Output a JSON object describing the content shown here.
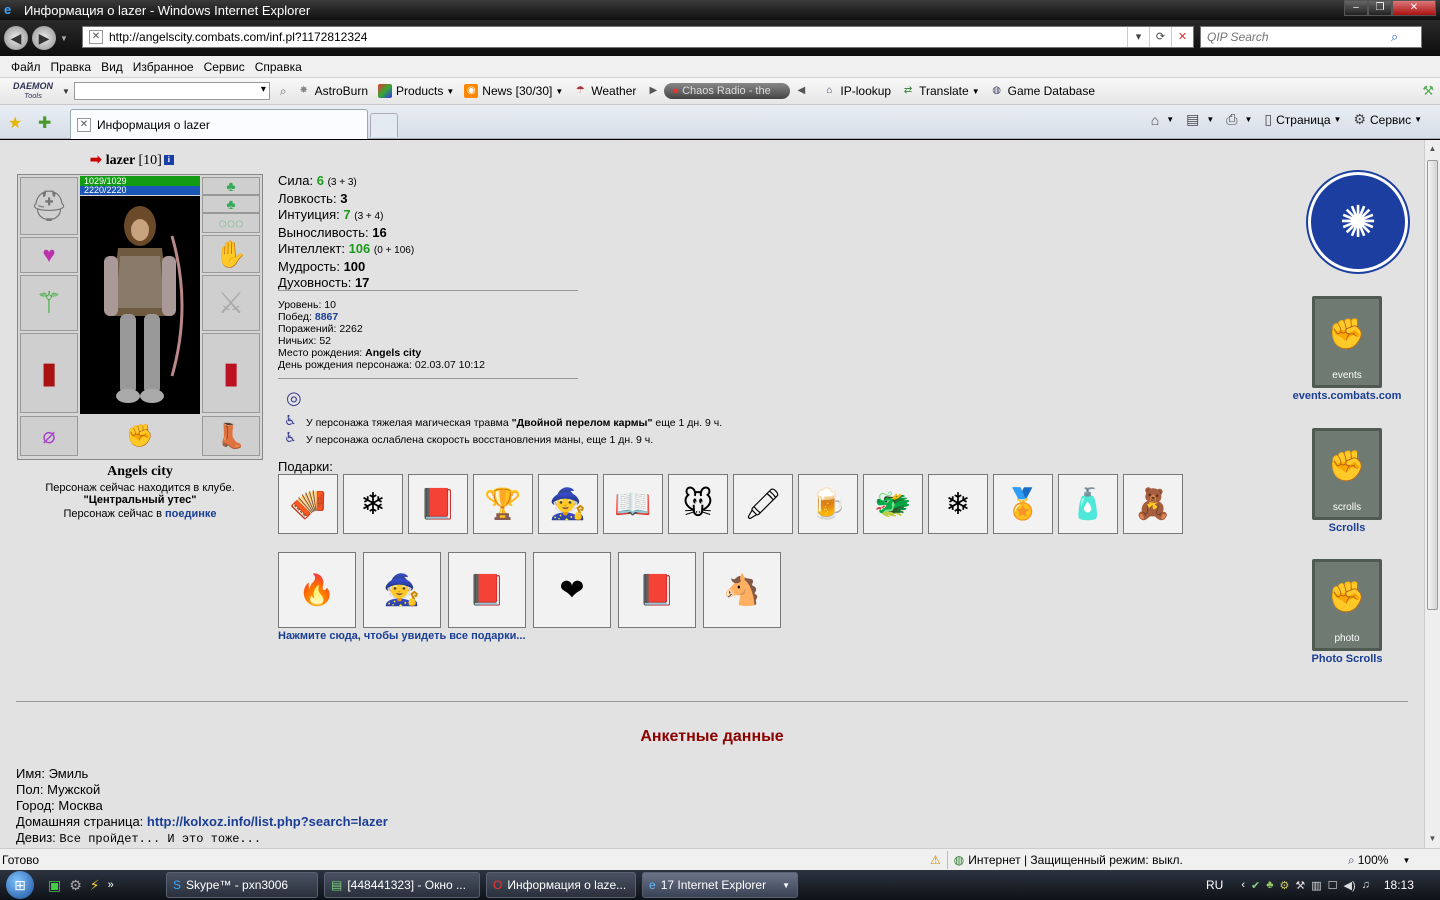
{
  "window": {
    "title": "Информация о lazer - Windows Internet Explorer",
    "buttons": [
      "–",
      "❐",
      "✕"
    ]
  },
  "address": {
    "url": "http://angelscity.combats.com/inf.pl?1172812324",
    "search_placeholder": "QIP Search"
  },
  "menu": [
    "Файл",
    "Правка",
    "Вид",
    "Избранное",
    "Сервис",
    "Справка"
  ],
  "links_toolbar": {
    "daemon_top": "DAEMON",
    "daemon_bottom": "Tools",
    "items": [
      {
        "label": "AstroBurn",
        "icon": "astroburn-icon"
      },
      {
        "label": "Products",
        "icon": "products-icon"
      },
      {
        "label": "News [30/30]",
        "icon": "rss-icon"
      },
      {
        "label": "Weather",
        "icon": "weather-icon"
      }
    ],
    "radio": "Chaos Radio - the",
    "items2": [
      {
        "label": "IP-lookup",
        "icon": "iplookup-icon"
      },
      {
        "label": "Translate",
        "icon": "translate-icon"
      },
      {
        "label": "Game Database",
        "icon": "database-icon"
      }
    ]
  },
  "tab": {
    "title": "Информация о lazer"
  },
  "commands": {
    "page": "Страница",
    "tools": "Сервис"
  },
  "character": {
    "name": "lazer",
    "level": "[10]",
    "hp": "1029/1029",
    "mana": "2220/2220",
    "city": "Angels city",
    "club_text": "Персонаж сейчас находится в клубе.",
    "club_name": "\"Центральный утес\"",
    "battle_text": "Персонаж сейчас в",
    "battle_link": "поединке"
  },
  "stats": [
    {
      "label": "Сила:",
      "value": "6",
      "extra": "(3 + 3)",
      "green": true
    },
    {
      "label": "Ловкость:",
      "value": "3",
      "extra": "",
      "green": false
    },
    {
      "label": "Интуиция:",
      "value": "7",
      "extra": "(3 + 4)",
      "green": true
    },
    {
      "label": "Выносливость:",
      "value": "16",
      "extra": "",
      "green": false
    },
    {
      "label": "Интеллект:",
      "value": "106",
      "extra": "(0 + 106)",
      "green": true
    },
    {
      "label": "Мудрость:",
      "value": "100",
      "extra": "",
      "green": false
    },
    {
      "label": "Духовность:",
      "value": "17",
      "extra": "",
      "green": false
    }
  ],
  "info": {
    "level_label": "Уровень:",
    "level": "10",
    "wins_label": "Побед:",
    "wins": "8867",
    "losses_label": "Поражений:",
    "losses": "2262",
    "draws_label": "Ничьих:",
    "draws": "52",
    "birthplace_label": "Место рождения:",
    "birthplace": "Angels city",
    "birthday_label": "День рождения персонажа:",
    "birthday": "02.03.07 10:12"
  },
  "effects": [
    {
      "pre": "У персонажа тяжелая магическая травма",
      "bold": "\"Двойной перелом кармы\"",
      "post": "еще 1 дн. 9 ч."
    },
    {
      "pre": "У персонажа ослаблена скорость восстановления маны, еще 1 дн. 9 ч.",
      "bold": "",
      "post": ""
    }
  ],
  "gifts": {
    "label": "Подарки:",
    "row1": [
      "🪗",
      "❄",
      "📕",
      "🏆",
      "🧙",
      "📖",
      "🐭",
      "🖍",
      "🍺",
      "🐲",
      "❄",
      "🏅",
      "🧴",
      "🧸"
    ],
    "row2": [
      "🔥",
      "🧙",
      "📕",
      "❤",
      "📕",
      "🐴"
    ],
    "all_link": "Нажмите сюда, чтобы увидеть все подарки..."
  },
  "sidebar": {
    "banners": [
      {
        "flag_text": "events",
        "caption": "events.combats.com"
      },
      {
        "flag_text": "scrolls",
        "caption": "Scrolls"
      },
      {
        "flag_text": "photo",
        "caption": "Photo Scrolls"
      }
    ]
  },
  "anketa": {
    "title": "Анкетные данные",
    "name_label": "Имя:",
    "name": "Эмиль",
    "sex_label": "Пол:",
    "sex": "Мужской",
    "city_label": "Город:",
    "city": "Москва",
    "homepage_label": "Домашняя страница:",
    "homepage": "http://kolxoz.info/list.php?search=lazer",
    "motto_label": "Девиз:",
    "motto": "Все пройдет... И это тоже..."
  },
  "status": {
    "text": "Готово",
    "zone": "Интернет | Защищенный режим: выкл.",
    "zoom": "100%"
  },
  "taskbar": {
    "tasks": [
      {
        "label": "Skype™ - pxn3006",
        "icon": "skype-icon"
      },
      {
        "label": "[448441323] - Окно ...",
        "icon": "qip-icon"
      },
      {
        "label": "Информация о laze...",
        "icon": "opera-icon"
      },
      {
        "label": "17 Internet Explorer",
        "icon": "ie-icon"
      }
    ],
    "lang": "RU",
    "clock": "18:13"
  }
}
